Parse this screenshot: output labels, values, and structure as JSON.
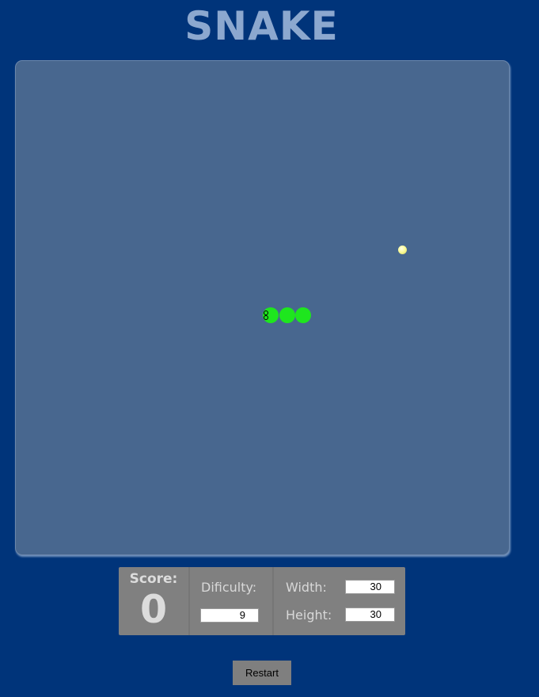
{
  "game": {
    "title": "SNAKE"
  },
  "board": {
    "background_color": "#48678f",
    "snake_color": "#1ee61e",
    "food_color": "#fbfb9a",
    "snake_length": 3,
    "direction": "left"
  },
  "stats": {
    "score_label": "Score:",
    "score_value": "0",
    "difficulty_label": "Dificulty:",
    "difficulty_value": "9",
    "width_label": "Width:",
    "width_value": "30",
    "height_label": "Height:",
    "height_value": "30"
  },
  "controls": {
    "restart_label": "Restart"
  }
}
